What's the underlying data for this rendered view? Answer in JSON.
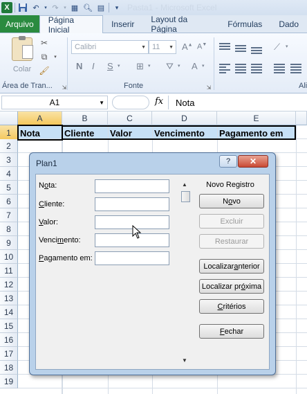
{
  "qat": {
    "app_icon": "X",
    "title_text": "Pasta1 - Microsoft Excel"
  },
  "tabs": [
    {
      "label": "Arquivo"
    },
    {
      "label": "Página Inicial"
    },
    {
      "label": "Inserir"
    },
    {
      "label": "Layout da Página"
    },
    {
      "label": "Fórmulas"
    },
    {
      "label": "Dado"
    }
  ],
  "ribbon": {
    "paste_label": "Colar",
    "clipboard_group": "Área de Tran...",
    "font_group": "Fonte",
    "font_name": "Calibri",
    "font_size": "11",
    "align_group": "Ali"
  },
  "formula_bar": {
    "name_box": "A1",
    "fx_label": "fx",
    "content": "Nota"
  },
  "sheet": {
    "columns": [
      "A",
      "B",
      "C",
      "D",
      "E"
    ],
    "rows": [
      "1",
      "2",
      "3",
      "4",
      "5",
      "6",
      "7",
      "8",
      "9",
      "10",
      "11",
      "12",
      "13",
      "14",
      "15",
      "16",
      "17",
      "18",
      "19"
    ],
    "header_cells": [
      "Nota",
      "Cliente",
      "Valor",
      "Vencimento",
      "Pagamento em"
    ]
  },
  "dialog": {
    "title": "Plan1",
    "help": "?",
    "close": "✕",
    "record_label": "Novo Registro",
    "fields": [
      {
        "label": "Nota:",
        "value": ""
      },
      {
        "label": "Cliente:",
        "value": ""
      },
      {
        "label": "Valor:",
        "value": ""
      },
      {
        "label": "Vencimento:",
        "value": ""
      },
      {
        "label": "Pagamento em:",
        "value": ""
      }
    ],
    "buttons": {
      "new": "Novo",
      "delete": "Excluir",
      "restore": "Restaurar",
      "find_prev": "Localizar anterior",
      "find_next": "Localizar próxima",
      "criteria": "Critérios",
      "close": "Fechar"
    }
  }
}
